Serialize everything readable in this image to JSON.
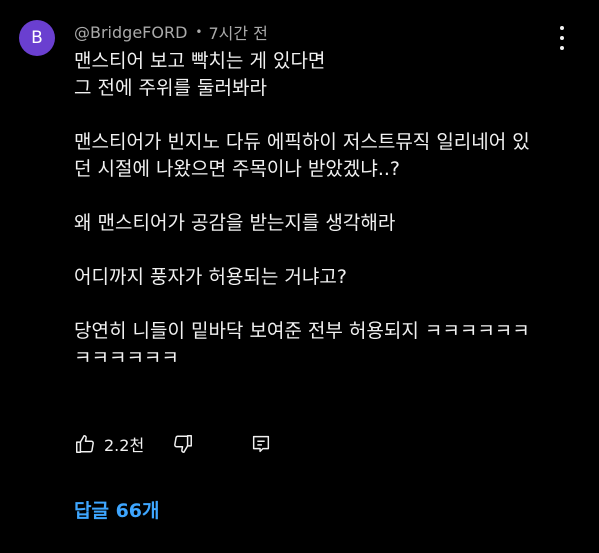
{
  "author": {
    "avatar_letter": "B",
    "avatar_color": "#6a3fd0",
    "handle": "@BridgeFORD",
    "separator": "•",
    "timestamp": "7시간 전"
  },
  "comment": {
    "paragraphs": [
      [
        "맨스티어 보고 빡치는 게 있다면",
        "그 전에 주위를 둘러봐라"
      ],
      [
        "맨스티어가 빈지노 다듀 에픽하이 저스트뮤직 일리네어 있",
        "던 시절에 나왔으면 주목이나 받았겠냐..?"
      ],
      [
        "왜 맨스티어가 공감을 받는지를 생각해라"
      ],
      [
        "어디까지 풍자가 허용되는 거냐고?"
      ],
      [
        "당연히 니들이 밑바닥 보여준 전부 허용되지 ㅋㅋㅋㅋㅋㅋ",
        "ㅋㅋㅋㅋㅋㅋ"
      ]
    ]
  },
  "actions": {
    "like_count": "2.2천",
    "like_icon": "thumbs-up-icon",
    "dislike_icon": "thumbs-down-icon",
    "reply_icon": "reply-comment-icon"
  },
  "replies": {
    "label": "답글 66개",
    "color": "#3ea6ff"
  },
  "menu": {
    "icon": "more-vertical-icon"
  }
}
